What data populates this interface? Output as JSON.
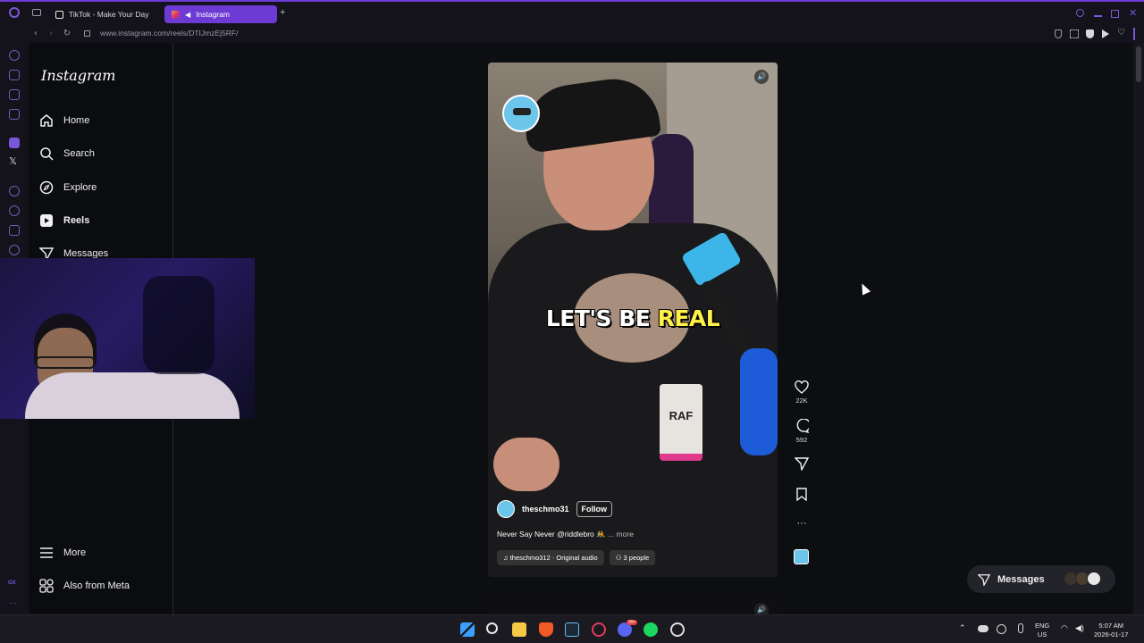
{
  "browser": {
    "tabs": [
      {
        "label": "TikTok - Make Your Day",
        "active": false
      },
      {
        "label": "Instagram",
        "active": true
      }
    ],
    "new_tab_symbol": "+",
    "url": "www.instagram.com/reels/DTIJmzEj5RF/"
  },
  "sidebar": {
    "logo": "Instagram",
    "items": [
      {
        "label": "Home",
        "icon": "home-icon"
      },
      {
        "label": "Search",
        "icon": "search-icon"
      },
      {
        "label": "Explore",
        "icon": "compass-icon"
      },
      {
        "label": "Reels",
        "icon": "reels-icon",
        "active": true
      },
      {
        "label": "Messages",
        "icon": "paper-plane-icon"
      }
    ],
    "more_label": "More",
    "meta_label": "Also from Meta"
  },
  "reel": {
    "caption_white": "LET'S BE ",
    "caption_yellow": "REAL",
    "badge_text": "RAF",
    "username": "theschmo31",
    "follow_label": "Follow",
    "description": "Never Say Never @riddlebro 🤼",
    "more_label": "... more",
    "audio": "theschmo312 · Original audio",
    "people": "3 people",
    "likes": "22K",
    "comments": "592"
  },
  "messages_bar": {
    "label": "Messages"
  },
  "taskbar": {
    "lang_top": "ENG",
    "lang_bottom": "US",
    "time": "5:07 AM",
    "date": "2026-01-17",
    "discord_badge": "99+"
  },
  "colors": {
    "accent": "#6d3bd4",
    "caption_highlight": "#fff14a",
    "badge_pink": "#e03a8c"
  }
}
